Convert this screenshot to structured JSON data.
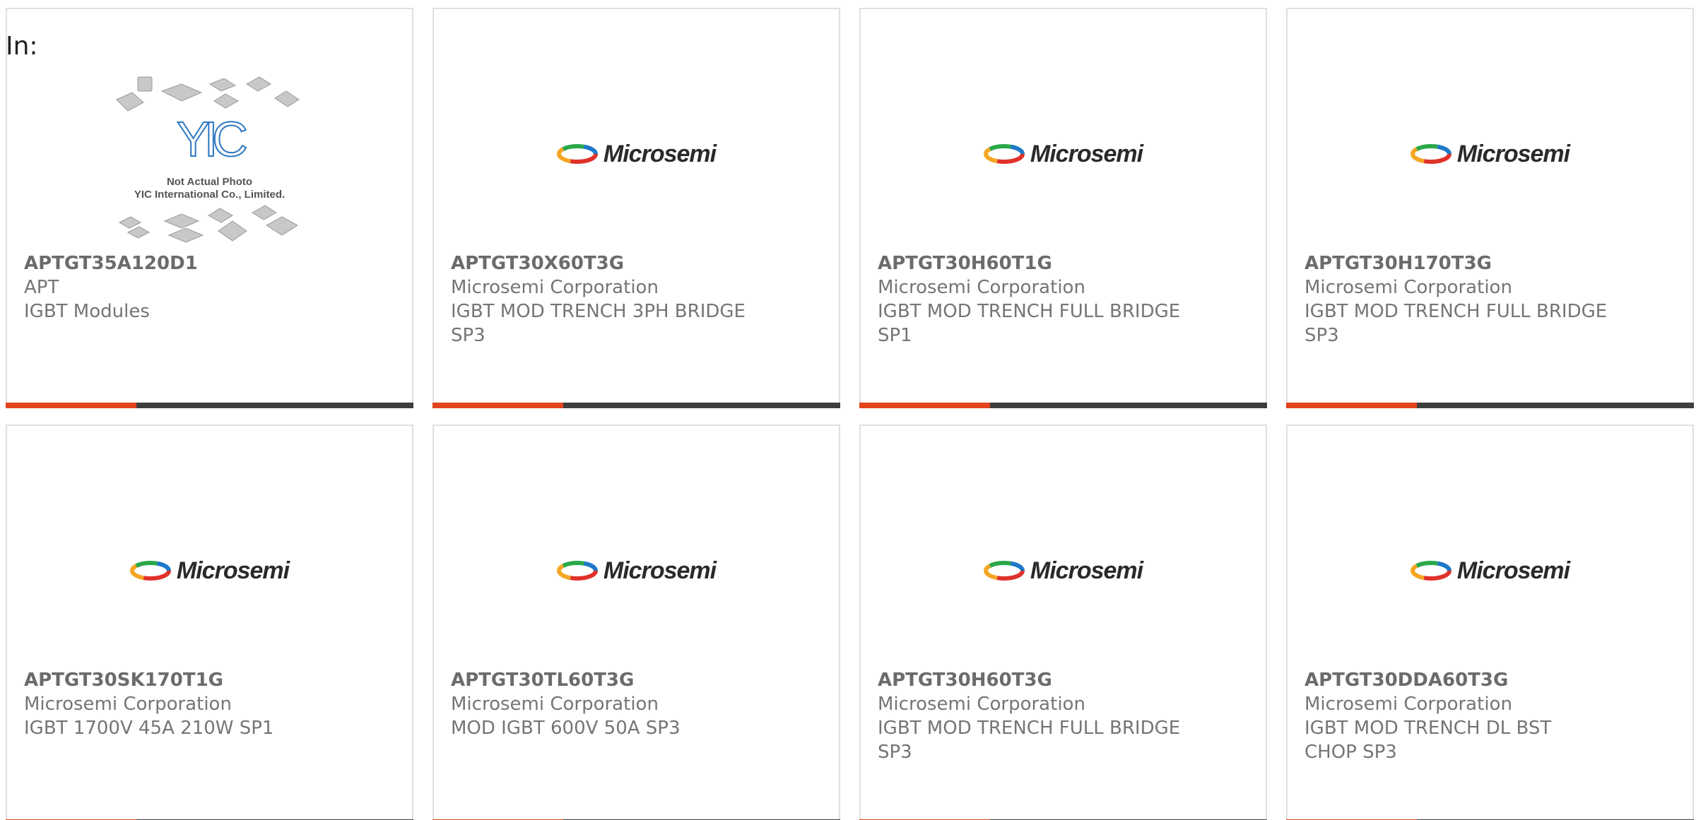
{
  "header": {
    "in_label": "In:"
  },
  "colors": {
    "card_border": "#e0e0e0",
    "bar_dark": "#3d3d3d",
    "bar_accent": "#e2431e",
    "text_gray": "#757575"
  },
  "placeholder_image": {
    "brand_logo": "YIC",
    "caption_line1": "Not Actual Photo",
    "caption_line2": "YIC International Co., Limited."
  },
  "microsemi_logo": {
    "text": "Microsemi",
    "icon": "microsemi-swoosh-icon"
  },
  "products": [
    {
      "part": "APTGT35A120D1",
      "manufacturer": "APT",
      "description": "IGBT Modules",
      "description2": "",
      "image": "placeholder"
    },
    {
      "part": "APTGT30X60T3G",
      "manufacturer": "Microsemi Corporation",
      "description": "IGBT MOD TRENCH 3PH BRIDGE",
      "description2": "SP3",
      "image": "microsemi"
    },
    {
      "part": "APTGT30H60T1G",
      "manufacturer": "Microsemi Corporation",
      "description": "IGBT MOD TRENCH FULL BRIDGE",
      "description2": "SP1",
      "image": "microsemi"
    },
    {
      "part": "APTGT30H170T3G",
      "manufacturer": "Microsemi Corporation",
      "description": "IGBT MOD TRENCH FULL BRIDGE",
      "description2": "SP3",
      "image": "microsemi"
    },
    {
      "part": "APTGT30SK170T1G",
      "manufacturer": "Microsemi Corporation",
      "description": "IGBT 1700V 45A 210W SP1",
      "description2": "",
      "image": "microsemi"
    },
    {
      "part": "APTGT30TL60T3G",
      "manufacturer": "Microsemi Corporation",
      "description": "MOD IGBT 600V 50A SP3",
      "description2": "",
      "image": "microsemi"
    },
    {
      "part": "APTGT30H60T3G",
      "manufacturer": "Microsemi Corporation",
      "description": "IGBT MOD TRENCH FULL BRIDGE",
      "description2": "SP3",
      "image": "microsemi"
    },
    {
      "part": "APTGT30DDA60T3G",
      "manufacturer": "Microsemi Corporation",
      "description": "IGBT MOD TRENCH DL BST",
      "description2": "CHOP SP3",
      "image": "microsemi"
    }
  ]
}
